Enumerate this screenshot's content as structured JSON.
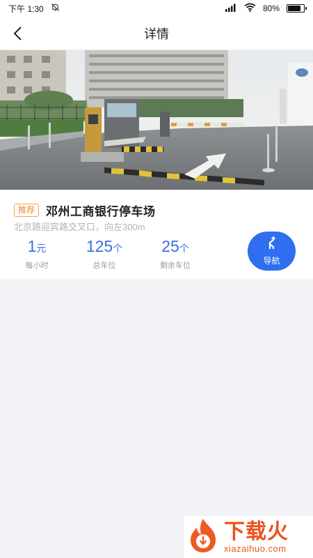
{
  "status_bar": {
    "time": "下午 1:30",
    "battery": "80%",
    "battery_level": 0.8
  },
  "header": {
    "title": "详情"
  },
  "parking": {
    "tag": "推荐",
    "name": "邓州工商银行停车场",
    "address": "北京路迎宾路交叉口，向左300m",
    "stats": [
      {
        "value": "1",
        "unit": "元",
        "label": "每小时"
      },
      {
        "value": "125",
        "unit": "个",
        "label": "总车位"
      },
      {
        "value": "25",
        "unit": "个",
        "label": "剩余车位"
      }
    ],
    "navigate_label": "导航"
  },
  "watermark": {
    "title": "下载火",
    "subtitle": "xiazaihuo.com"
  },
  "colors": {
    "accent": "#2f6ef0",
    "stat_text": "#3b6fe0",
    "tag": "#f08a24",
    "watermark": "#e8531f"
  }
}
